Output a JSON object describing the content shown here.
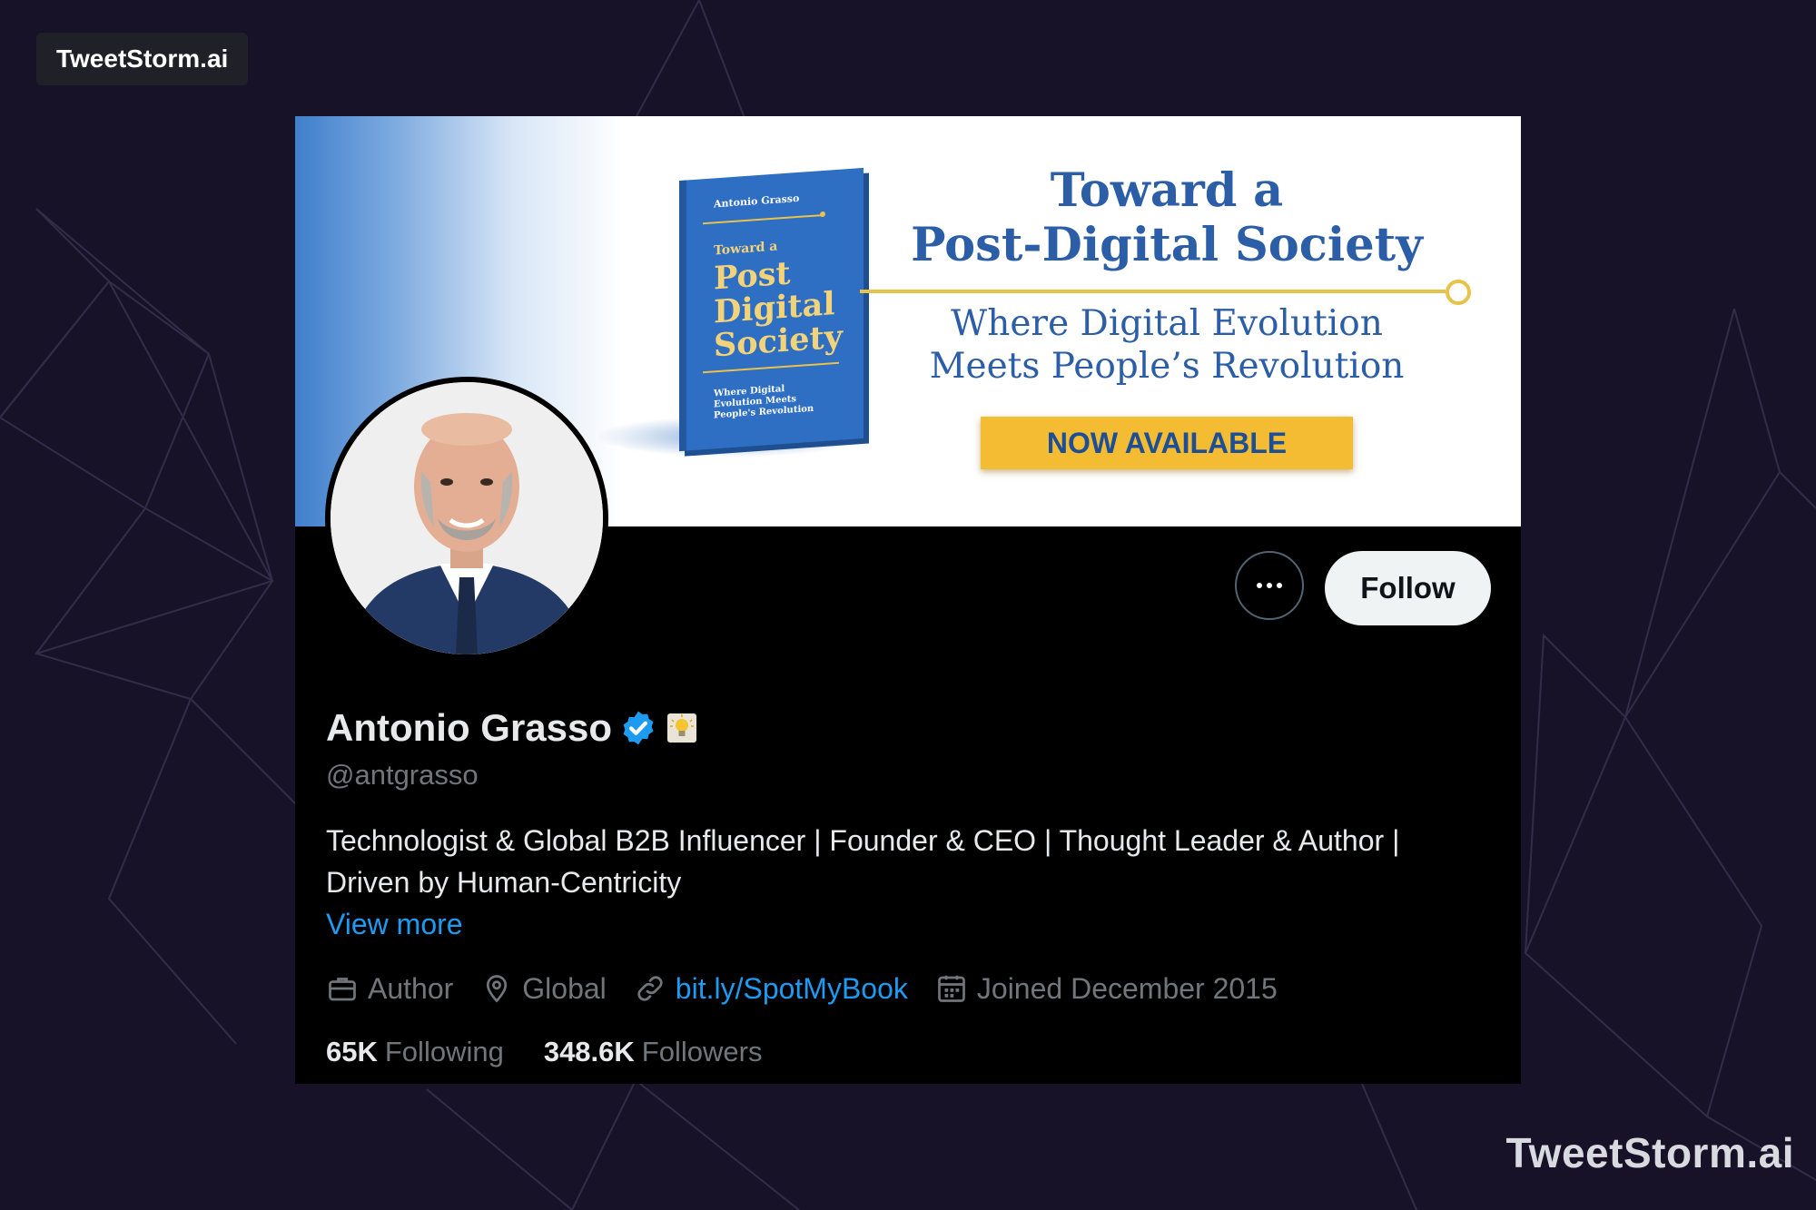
{
  "brand": {
    "badge_text": "TweetStorm.ai",
    "watermark_text": "TweetStorm.ai"
  },
  "banner": {
    "book": {
      "author": "Antonio Grasso",
      "title_prefix": "Toward a",
      "title": "Post Digital Society",
      "subtitle": "Where Digital Evolution Meets People's Revolution"
    },
    "title_line1": "Toward a",
    "title_line2": "Post-Digital Society",
    "subtitle_line1": "Where Digital Evolution",
    "subtitle_line2": "Meets People’s Revolution",
    "cta": "NOW AVAILABLE"
  },
  "profile": {
    "name": "Antonio Grasso",
    "handle": "@antgrasso",
    "verified": true,
    "badge_icon": "lightbulb-label-icon",
    "bio_line1": "Technologist & Global B2B Influencer | Founder & CEO | Thought Leader & Author |",
    "bio_line2": "Driven by Human-Centricity",
    "view_more": "View more",
    "meta": {
      "profession": "Author",
      "location": "Global",
      "website": "bit.ly/SpotMyBook",
      "joined": "Joined December 2015"
    },
    "stats": {
      "following_count": "65K",
      "following_label": "Following",
      "followers_count": "348.6K",
      "followers_label": "Followers"
    }
  },
  "actions": {
    "more_icon": "more-icon",
    "follow_label": "Follow"
  },
  "colors": {
    "page_background": "#181229",
    "accent_blue": "#1d9bf0",
    "banner_blue": "#2b5ea6",
    "banner_gold": "#f4bc32",
    "text_primary": "#e7e9ea",
    "text_secondary": "#71767b"
  }
}
